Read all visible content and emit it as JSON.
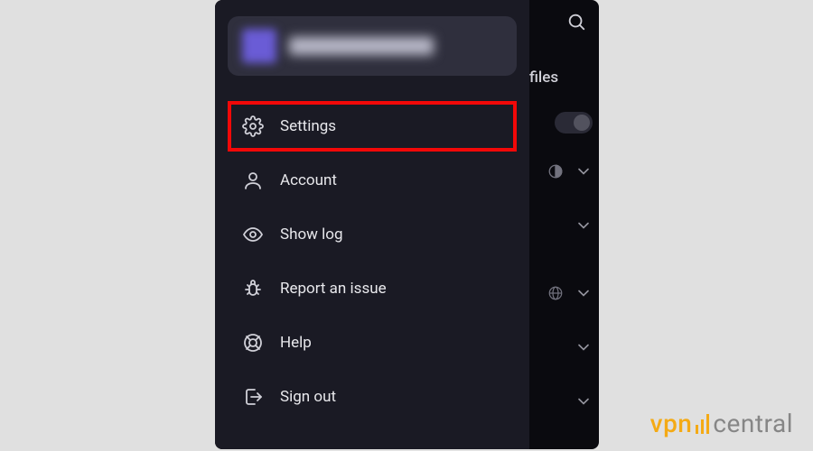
{
  "drawer": {
    "items": [
      {
        "id": "settings",
        "label": "Settings",
        "icon": "gear-icon",
        "highlighted": true
      },
      {
        "id": "account",
        "label": "Account",
        "icon": "user-icon",
        "highlighted": false
      },
      {
        "id": "showlog",
        "label": "Show log",
        "icon": "eye-icon",
        "highlighted": false
      },
      {
        "id": "report",
        "label": "Report an issue",
        "icon": "bug-icon",
        "highlighted": false
      },
      {
        "id": "help",
        "label": "Help",
        "icon": "lifebuoy-icon",
        "highlighted": false
      },
      {
        "id": "signout",
        "label": "Sign out",
        "icon": "signout-icon",
        "highlighted": false
      }
    ]
  },
  "background": {
    "visible_header_fragment": "files",
    "search_icon": "search-icon",
    "toggle_state": "off"
  },
  "highlight_color": "#f20808",
  "watermark": {
    "brand_left": "vpn",
    "brand_right": "central"
  }
}
